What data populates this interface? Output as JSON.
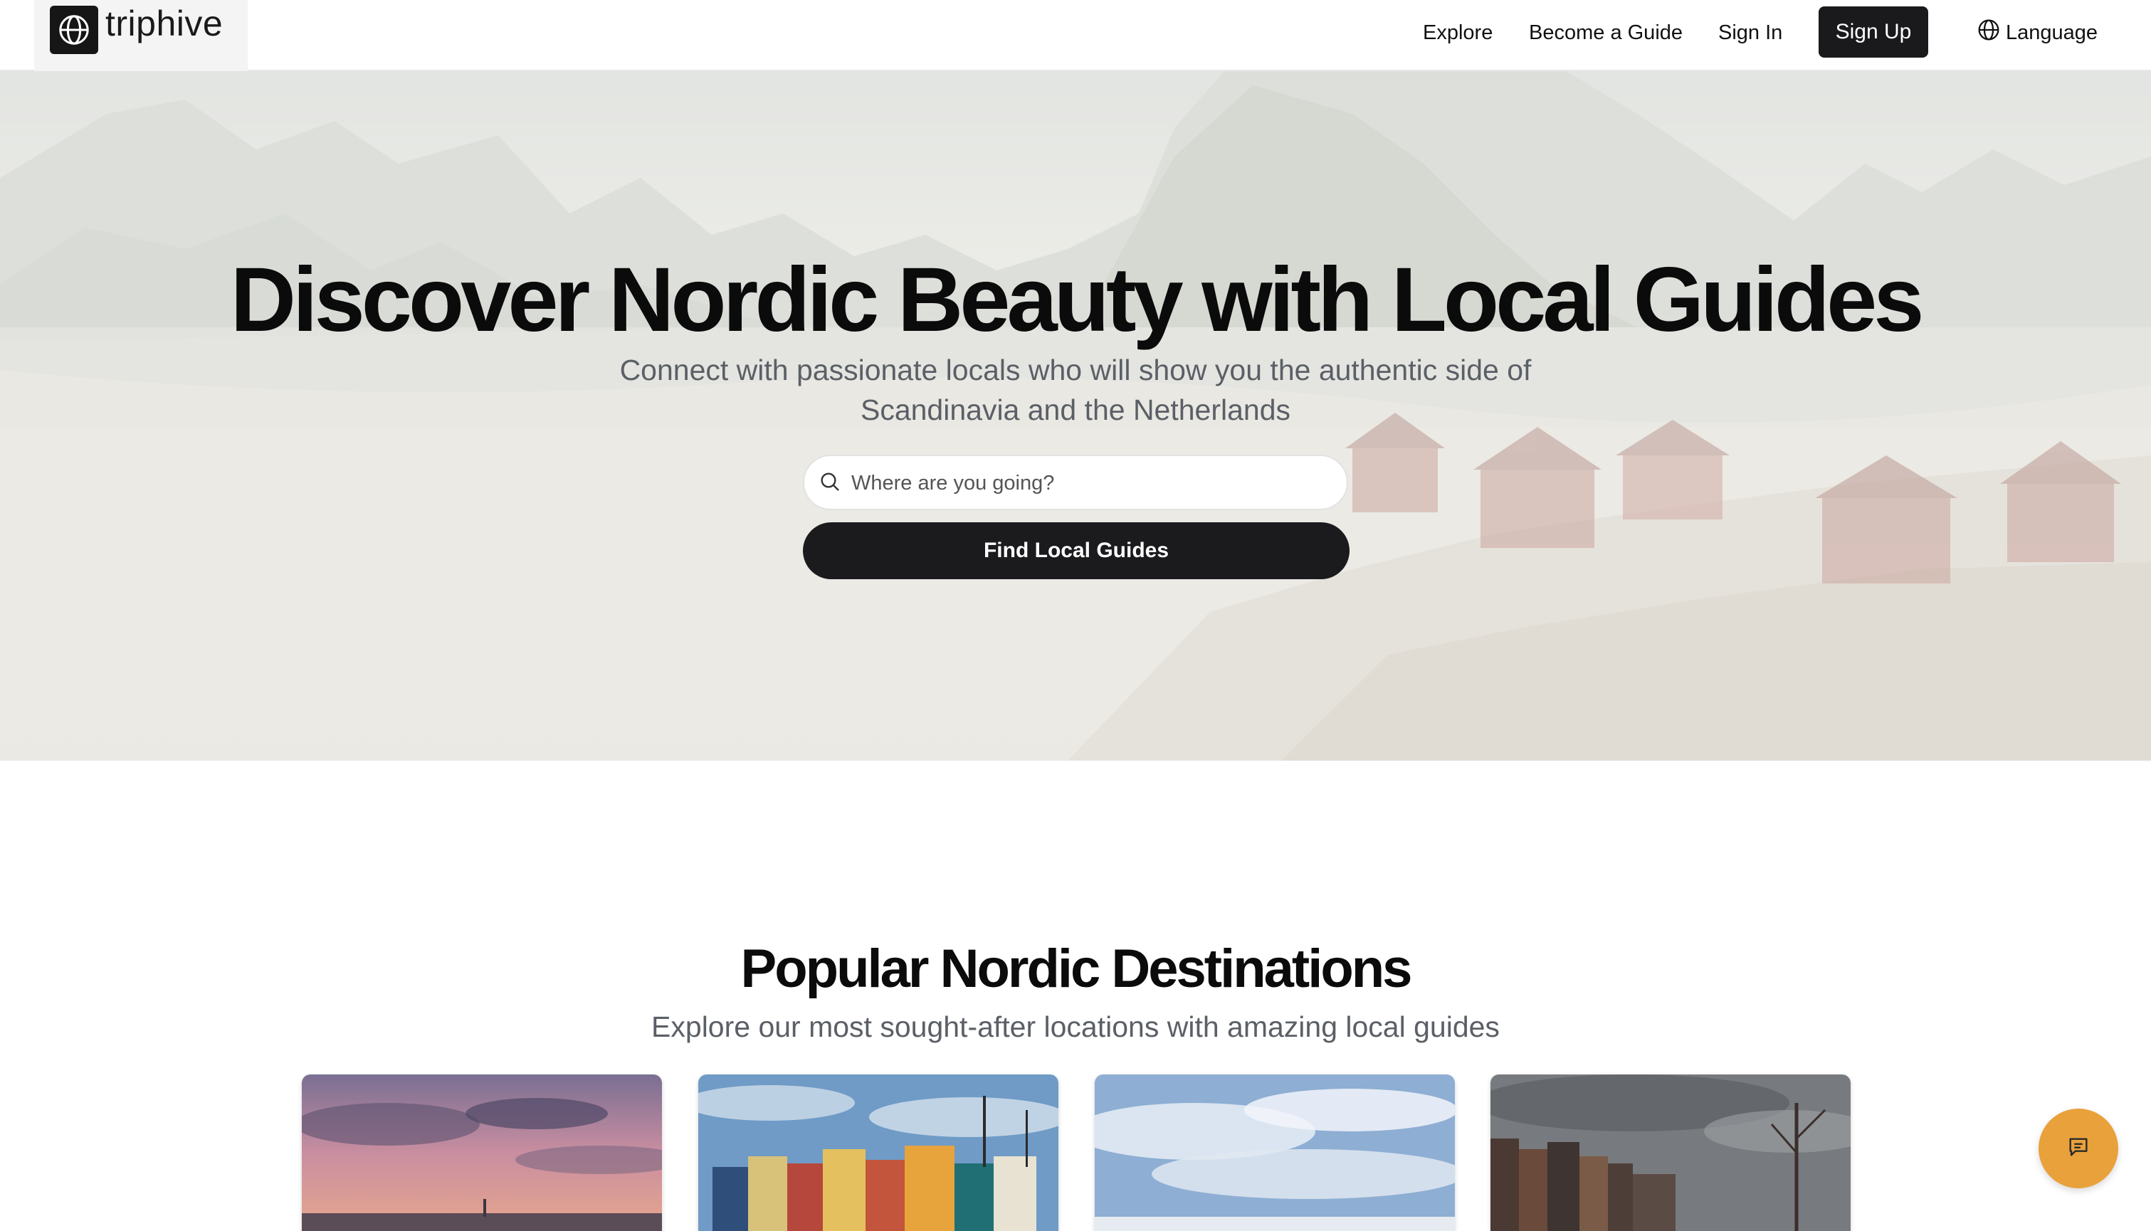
{
  "brand": {
    "name": "triphive"
  },
  "nav": {
    "explore": "Explore",
    "become_guide": "Become a Guide",
    "sign_in": "Sign In",
    "sign_up": "Sign Up",
    "language": "Language"
  },
  "hero": {
    "title": "Discover Nordic Beauty with Local Guides",
    "subtitle": "Connect with passionate locals who will show you the authentic side of Scandinavia and the Netherlands",
    "search_placeholder": "Where are you going?",
    "search_value": "",
    "cta": "Find Local Guides"
  },
  "destinations": {
    "title": "Popular Nordic Destinations",
    "subtitle": "Explore our most sought-after locations with amazing local guides",
    "cards": [
      "sunset-harbor-image",
      "colorful-harbor-houses-image",
      "cloudy-sky-image",
      "canal-houses-image"
    ]
  },
  "colors": {
    "primary_dark": "#1b1b1d",
    "chat_accent": "#e9a13b",
    "muted_text": "#5b5f66"
  },
  "icons": {
    "logo": "globe-icon",
    "language": "globe-icon",
    "search": "search-icon",
    "chat": "chat-icon"
  }
}
